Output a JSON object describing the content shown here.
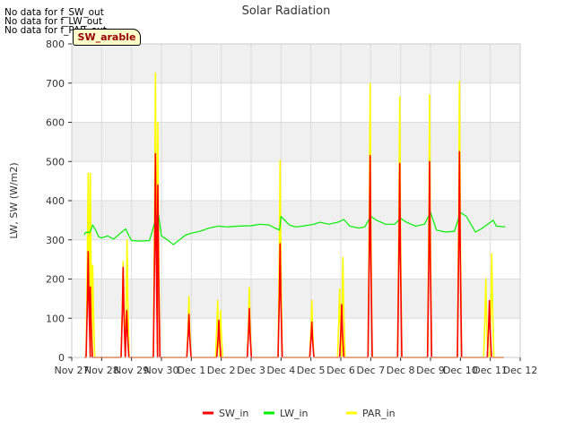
{
  "messages": [
    "No data for f_SW_out",
    "No data for f_LW_out",
    "No data for f_PAR_out"
  ],
  "badge_label": "SW_arable",
  "chart_data": {
    "type": "line",
    "title": "Solar Radiation",
    "xlabel": "",
    "ylabel": "LW, SW (W/m2)",
    "x_ticks": [
      "Nov 27",
      "Nov 28",
      "Nov 29",
      "Nov 30",
      "Dec 1",
      "Dec 2",
      "Dec 3",
      "Dec 4",
      "Dec 5",
      "Dec 6",
      "Dec 7",
      "Dec 8",
      "Dec 9",
      "Dec 10",
      "Dec 11",
      "Dec 12"
    ],
    "y_ticks": [
      0,
      100,
      200,
      300,
      400,
      500,
      600,
      700,
      800
    ],
    "xlim": [
      0,
      15
    ],
    "ylim": [
      0,
      800
    ],
    "grid": true,
    "legend_position": "bottom",
    "series": [
      {
        "name": "SW_in",
        "color": "#ff0000",
        "peaks": [
          [
            0.55,
            270
          ],
          [
            0.62,
            180
          ],
          [
            1.72,
            230
          ],
          [
            1.84,
            120
          ],
          [
            2.8,
            520
          ],
          [
            2.88,
            440
          ],
          [
            3.92,
            110
          ],
          [
            4.92,
            95
          ],
          [
            5.94,
            125
          ],
          [
            6.97,
            290
          ],
          [
            8.03,
            90
          ],
          [
            9.03,
            135
          ],
          [
            9.98,
            515
          ],
          [
            10.97,
            495
          ],
          [
            11.97,
            500
          ],
          [
            12.97,
            525
          ],
          [
            13.97,
            145
          ]
        ]
      },
      {
        "name": "LW_in",
        "color": "#00ee00",
        "points": [
          [
            0.42,
            313
          ],
          [
            0.45,
            318
          ],
          [
            0.55,
            320
          ],
          [
            0.6,
            318
          ],
          [
            0.7,
            338
          ],
          [
            0.8,
            325
          ],
          [
            0.9,
            308
          ],
          [
            1.0,
            305
          ],
          [
            1.2,
            310
          ],
          [
            1.4,
            302
          ],
          [
            1.6,
            315
          ],
          [
            1.8,
            328
          ],
          [
            1.95,
            305
          ],
          [
            2.0,
            298
          ],
          [
            2.3,
            297
          ],
          [
            2.6,
            298
          ],
          [
            2.8,
            350
          ],
          [
            2.9,
            365
          ],
          [
            3.0,
            310
          ],
          [
            3.2,
            300
          ],
          [
            3.4,
            288
          ],
          [
            3.6,
            300
          ],
          [
            3.8,
            312
          ],
          [
            4.0,
            317
          ],
          [
            4.3,
            322
          ],
          [
            4.6,
            330
          ],
          [
            4.9,
            335
          ],
          [
            5.2,
            333
          ],
          [
            5.6,
            335
          ],
          [
            6.0,
            336
          ],
          [
            6.3,
            340
          ],
          [
            6.6,
            338
          ],
          [
            6.8,
            330
          ],
          [
            6.95,
            325
          ],
          [
            7.0,
            360
          ],
          [
            7.15,
            348
          ],
          [
            7.3,
            337
          ],
          [
            7.5,
            333
          ],
          [
            7.8,
            336
          ],
          [
            8.1,
            340
          ],
          [
            8.3,
            345
          ],
          [
            8.6,
            340
          ],
          [
            8.9,
            345
          ],
          [
            9.1,
            352
          ],
          [
            9.3,
            335
          ],
          [
            9.6,
            330
          ],
          [
            9.8,
            333
          ],
          [
            10.0,
            360
          ],
          [
            10.2,
            350
          ],
          [
            10.5,
            340
          ],
          [
            10.8,
            340
          ],
          [
            11.0,
            355
          ],
          [
            11.2,
            345
          ],
          [
            11.5,
            335
          ],
          [
            11.8,
            340
          ],
          [
            12.0,
            370
          ],
          [
            12.2,
            325
          ],
          [
            12.5,
            320
          ],
          [
            12.8,
            322
          ],
          [
            13.0,
            370
          ],
          [
            13.2,
            360
          ],
          [
            13.5,
            320
          ],
          [
            13.7,
            328
          ],
          [
            14.0,
            345
          ],
          [
            14.1,
            350
          ],
          [
            14.2,
            335
          ],
          [
            14.5,
            333
          ]
        ]
      },
      {
        "name": "PAR_in",
        "color": "#ffff00",
        "peaks": [
          [
            0.55,
            470
          ],
          [
            0.62,
            470
          ],
          [
            0.7,
            235
          ],
          [
            1.72,
            245
          ],
          [
            1.85,
            300
          ],
          [
            2.8,
            725
          ],
          [
            2.88,
            600
          ],
          [
            3.92,
            155
          ],
          [
            4.88,
            145
          ],
          [
            4.98,
            120
          ],
          [
            5.94,
            178
          ],
          [
            6.97,
            503
          ],
          [
            8.03,
            145
          ],
          [
            8.96,
            175
          ],
          [
            9.07,
            255
          ],
          [
            9.98,
            700
          ],
          [
            10.97,
            665
          ],
          [
            11.97,
            670
          ],
          [
            12.97,
            705
          ],
          [
            13.85,
            200
          ],
          [
            14.05,
            265
          ]
        ]
      }
    ]
  }
}
